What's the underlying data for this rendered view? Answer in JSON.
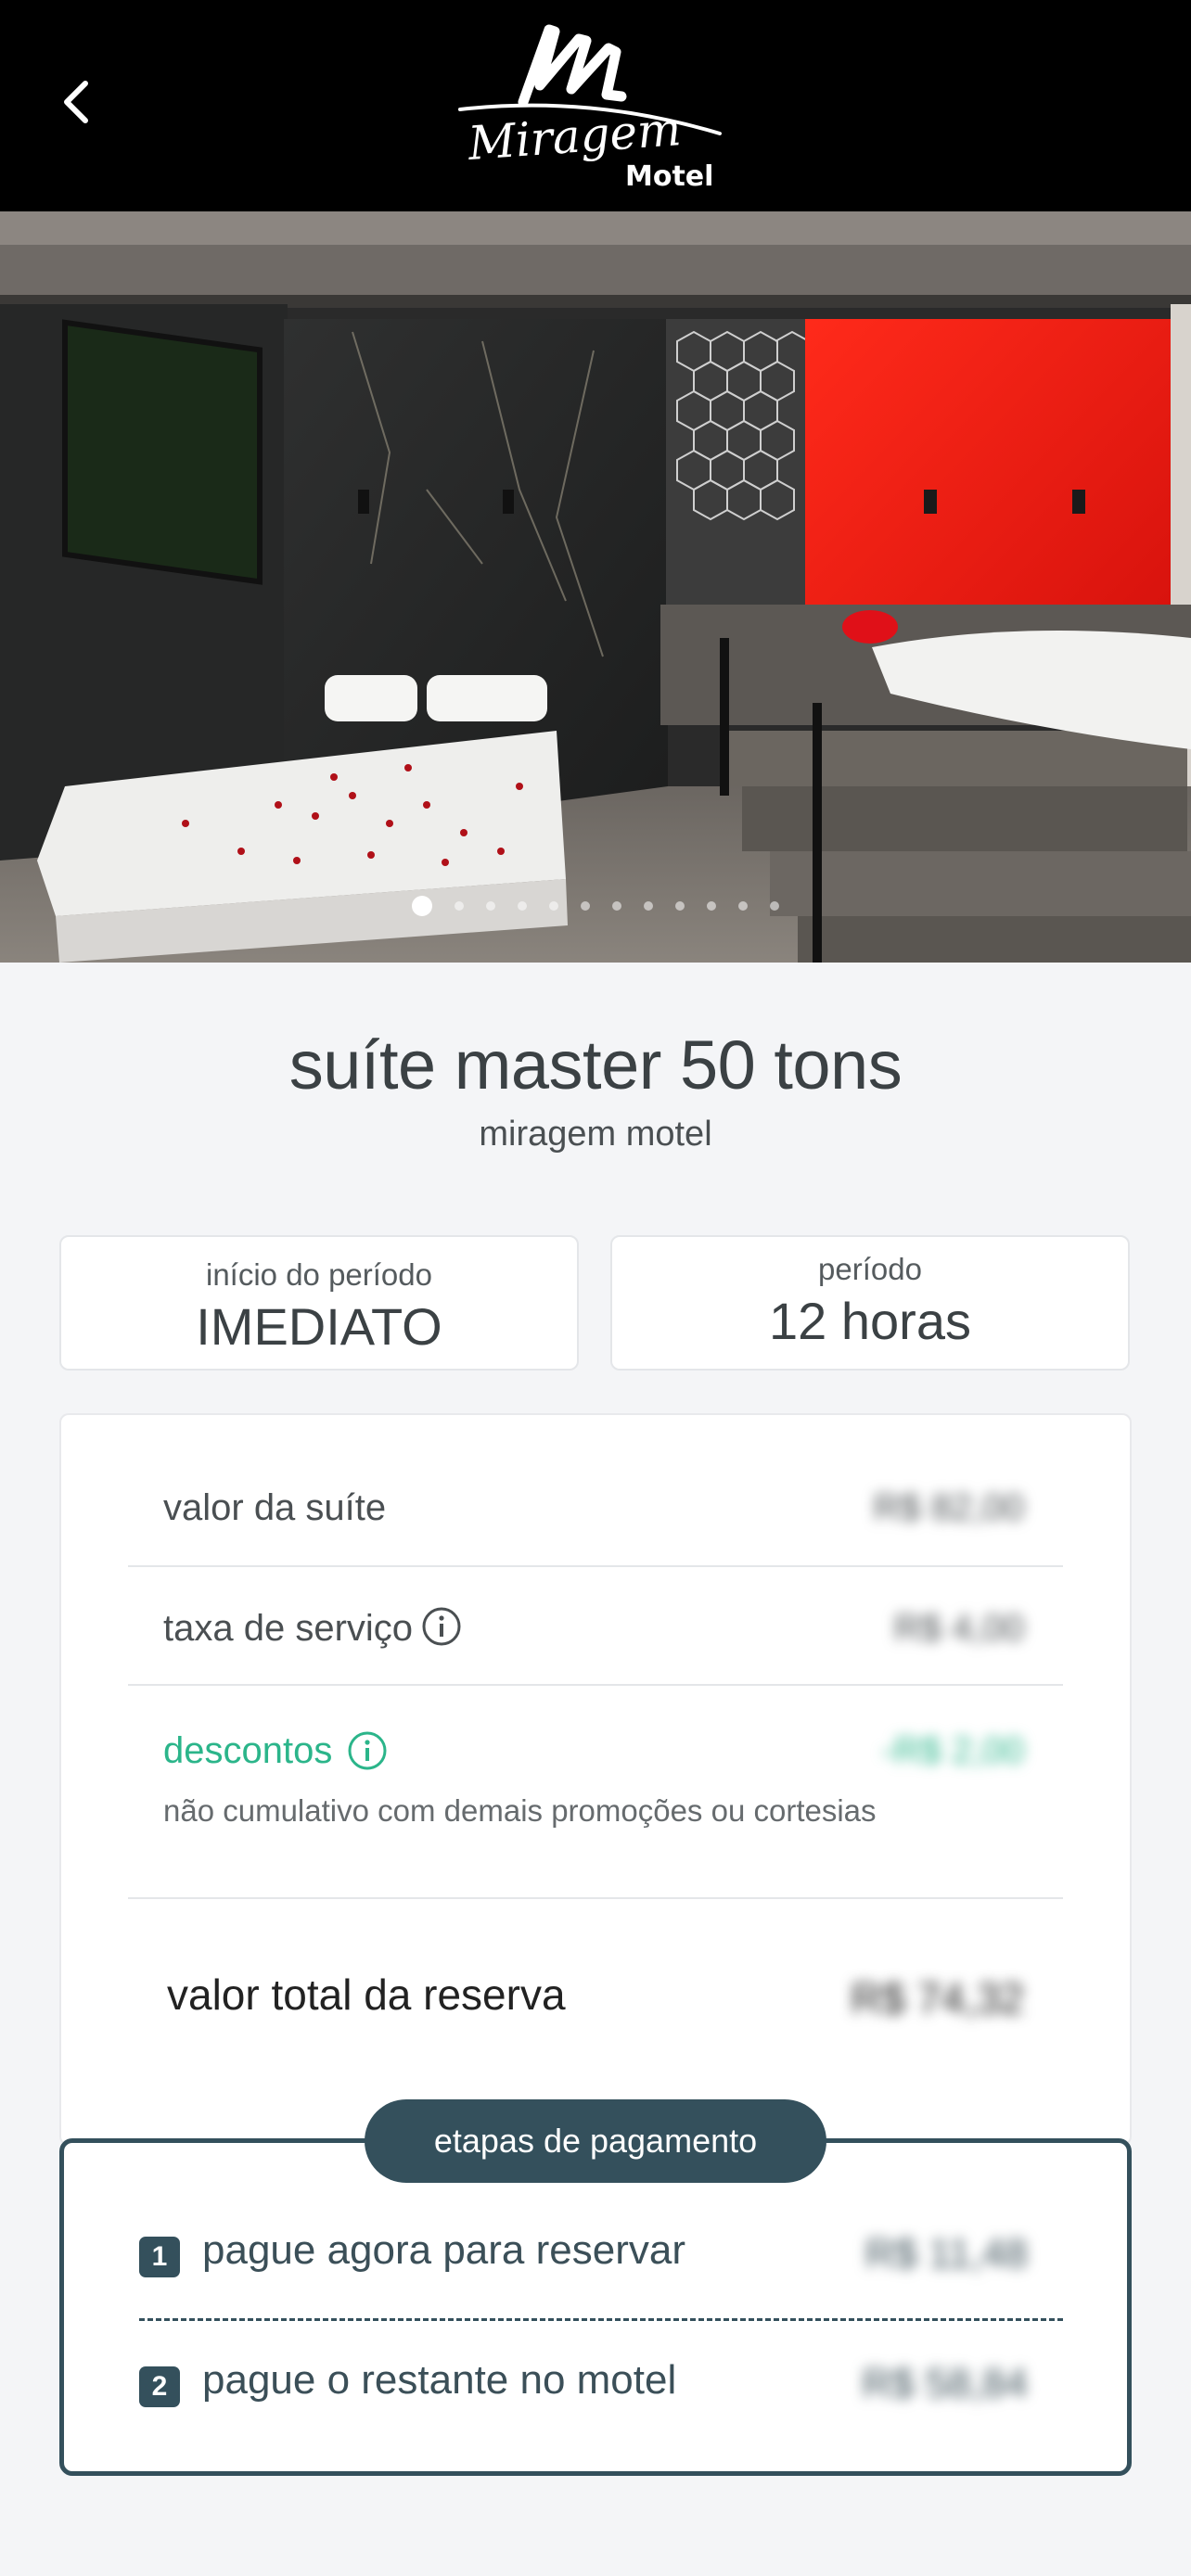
{
  "header": {
    "logo_text": "Miragem",
    "logo_subtext": "Motel"
  },
  "gallery": {
    "photo_count": 12,
    "active_index": 0
  },
  "suite": {
    "title": "suíte master 50 tons",
    "motel": "miragem motel"
  },
  "period": {
    "start_label": "início do período",
    "start_value": "IMEDIATO",
    "length_label": "período",
    "length_value": "12 horas"
  },
  "pricing": {
    "suite_value_label": "valor da suíte",
    "suite_value": "R$ 82,00",
    "service_fee_label": "taxa de serviço",
    "service_fee": "R$ 4,00",
    "discounts_label": "descontos",
    "discounts_value": "-R$ 2,00",
    "discounts_note": "não cumulativo com demais promoções ou cortesias",
    "total_label": "valor total da reserva",
    "total_value": "R$ 74,32"
  },
  "payment_steps": {
    "title": "etapas de pagamento",
    "steps": [
      {
        "number": "1",
        "label": "pague agora para reservar",
        "value": "R$ 11,48"
      },
      {
        "number": "2",
        "label": "pague o restante no motel",
        "value": "R$ 58,84"
      }
    ]
  },
  "colors": {
    "primary": "#34505c",
    "discount": "#2bb58a",
    "background": "#f4f5f7"
  }
}
